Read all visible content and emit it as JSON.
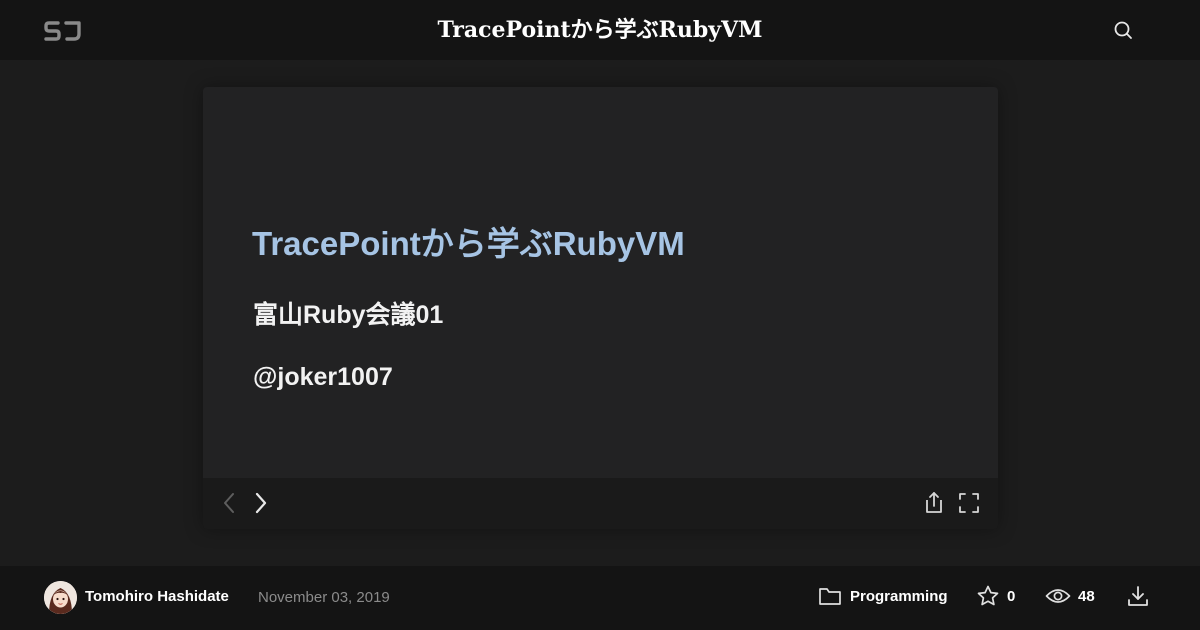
{
  "header": {
    "logo_icon": "sj-logo-icon",
    "title": "TracePointから学ぶRubyVM",
    "search_icon": "search-icon"
  },
  "slide": {
    "title": "TracePointから学ぶRubyVM",
    "event": "富山Ruby会議01",
    "handle": "@joker1007",
    "title_color": "#a6c4e4"
  },
  "controls": {
    "prev_icon": "chevron-left-icon",
    "next_icon": "chevron-right-icon",
    "share_icon": "share-icon",
    "fullscreen_icon": "fullscreen-icon"
  },
  "footer": {
    "author": "Tomohiro Hashidate",
    "date": "November 03, 2019",
    "category": "Programming",
    "stars": "0",
    "views": "48",
    "icons": [
      "folder-icon",
      "star-icon",
      "eye-icon",
      "download-icon"
    ]
  }
}
